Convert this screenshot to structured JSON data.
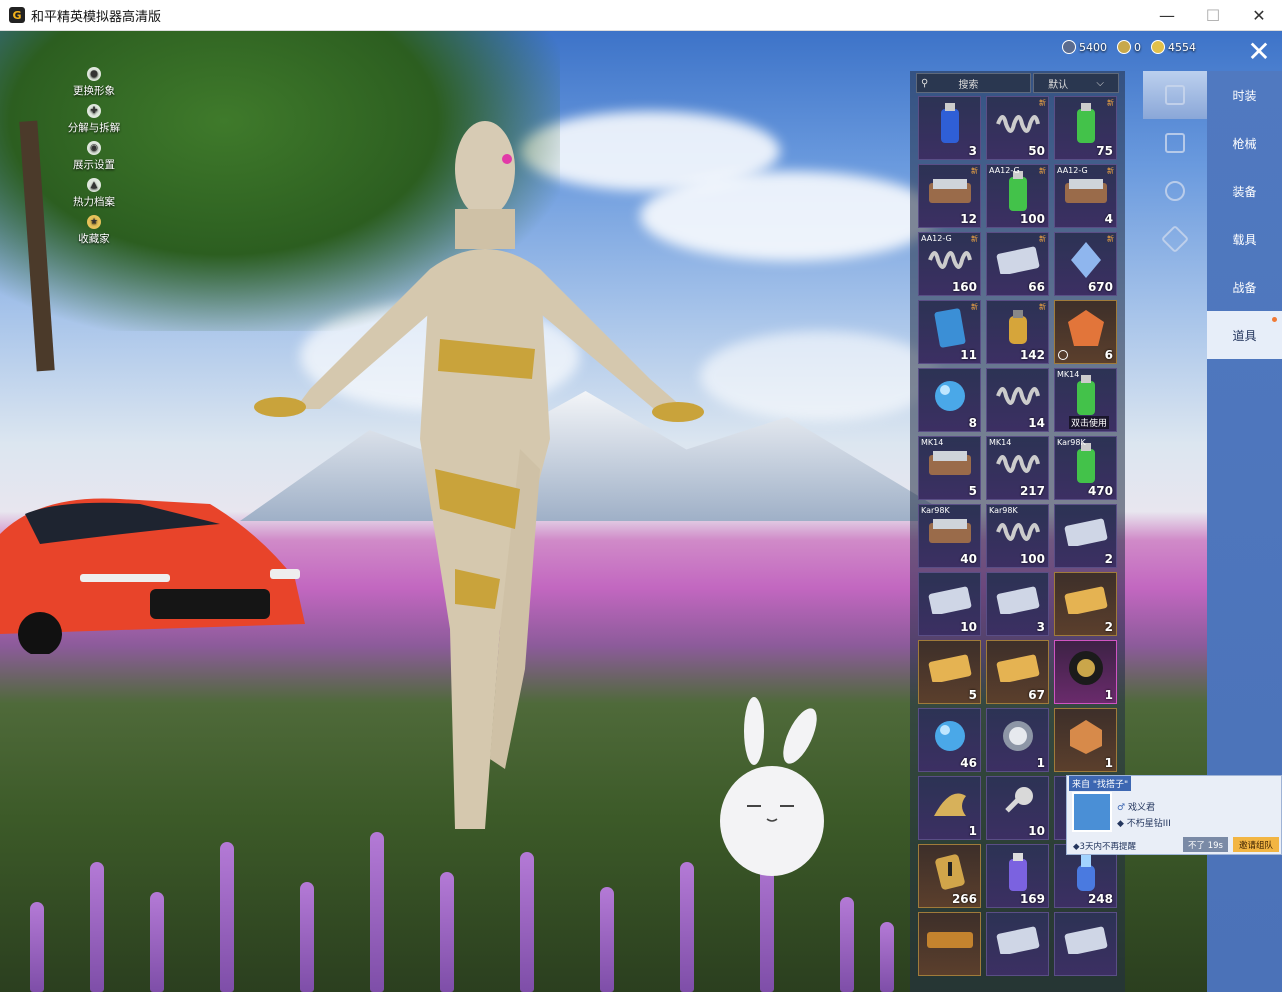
{
  "window": {
    "title": "和平精英模拟器高清版",
    "icon_letter": "G",
    "buttons": [
      "—",
      "☐",
      "✕"
    ]
  },
  "side_menu": [
    {
      "label": "更换形象",
      "icon": "person-icon"
    },
    {
      "label": "分解与拆解",
      "icon": "puzzle-icon"
    },
    {
      "label": "展示设置",
      "icon": "eye-icon"
    },
    {
      "label": "热力档案",
      "icon": "flame-icon"
    },
    {
      "label": "收藏家",
      "icon": "badge-icon"
    }
  ],
  "currency": [
    {
      "value": "5400",
      "color": "#5b6c8f",
      "icon": "coupon-icon"
    },
    {
      "value": "0",
      "color": "#c8a84a",
      "icon": "token-icon"
    },
    {
      "value": "4554",
      "color": "#e2c04a",
      "icon": "gold-coin-icon"
    }
  ],
  "close_label": "✕",
  "inventory": {
    "search_placeholder": "搜索",
    "sort_label": "默认",
    "sort_arrow": "⌵",
    "items": [
      {
        "tag": "",
        "qty": "3",
        "kind": "can-blue",
        "style": ""
      },
      {
        "tag": "",
        "qty": "50",
        "kind": "spring",
        "style": "",
        "new": "新"
      },
      {
        "tag": "",
        "qty": "75",
        "kind": "can-green",
        "style": "",
        "new": "新"
      },
      {
        "tag": "",
        "qty": "12",
        "kind": "case",
        "style": "",
        "new": "新"
      },
      {
        "tag": "AA12-G",
        "qty": "100",
        "kind": "can-green",
        "style": "",
        "new": "新"
      },
      {
        "tag": "AA12-G",
        "qty": "4",
        "kind": "case",
        "style": "",
        "new": "新"
      },
      {
        "tag": "AA12-G",
        "qty": "160",
        "kind": "spring",
        "style": "",
        "new": "新"
      },
      {
        "tag": "",
        "qty": "66",
        "kind": "ticket",
        "style": "",
        "new": "新"
      },
      {
        "tag": "",
        "qty": "670",
        "kind": "diamond",
        "style": "",
        "new": "新"
      },
      {
        "tag": "",
        "qty": "11",
        "kind": "card",
        "style": "",
        "new": "新"
      },
      {
        "tag": "",
        "qty": "142",
        "kind": "grenade",
        "style": "",
        "new": "新"
      },
      {
        "tag": "",
        "qty": "6",
        "kind": "emblem",
        "style": "gold",
        "badge": true
      },
      {
        "tag": "",
        "qty": "8",
        "kind": "orb",
        "style": ""
      },
      {
        "tag": "",
        "qty": "14",
        "kind": "spring",
        "style": ""
      },
      {
        "tag": "MK14",
        "qty": "",
        "kind": "can-green",
        "style": "",
        "action": "双击使用"
      },
      {
        "tag": "MK14",
        "qty": "5",
        "kind": "case",
        "style": ""
      },
      {
        "tag": "MK14",
        "qty": "217",
        "kind": "spring",
        "style": ""
      },
      {
        "tag": "Kar98K",
        "qty": "470",
        "kind": "can-green",
        "style": ""
      },
      {
        "tag": "Kar98K",
        "qty": "40",
        "kind": "case",
        "style": ""
      },
      {
        "tag": "Kar98K",
        "qty": "100",
        "kind": "spring",
        "style": ""
      },
      {
        "tag": "",
        "qty": "2",
        "kind": "ticket",
        "style": ""
      },
      {
        "tag": "",
        "qty": "10",
        "kind": "ticket",
        "style": ""
      },
      {
        "tag": "",
        "qty": "3",
        "kind": "ticket",
        "style": ""
      },
      {
        "tag": "",
        "qty": "2",
        "kind": "ticket-gold",
        "style": "gold"
      },
      {
        "tag": "",
        "qty": "5",
        "kind": "ticket-gold",
        "style": "gold"
      },
      {
        "tag": "",
        "qty": "67",
        "kind": "ticket-gold",
        "style": "gold"
      },
      {
        "tag": "",
        "qty": "1",
        "kind": "lion",
        "style": "pink"
      },
      {
        "tag": "",
        "qty": "46",
        "kind": "orb",
        "style": ""
      },
      {
        "tag": "",
        "qty": "1",
        "kind": "coin",
        "style": ""
      },
      {
        "tag": "",
        "qty": "1",
        "kind": "medal",
        "style": "gold"
      },
      {
        "tag": "",
        "qty": "1",
        "kind": "dragon",
        "style": ""
      },
      {
        "tag": "",
        "qty": "10",
        "kind": "key",
        "style": ""
      },
      {
        "tag": "",
        "qty": "",
        "kind": "blank",
        "style": ""
      },
      {
        "tag": "",
        "qty": "266",
        "kind": "warning",
        "style": "gold"
      },
      {
        "tag": "",
        "qty": "169",
        "kind": "spray",
        "style": ""
      },
      {
        "tag": "",
        "qty": "248",
        "kind": "potion",
        "style": ""
      },
      {
        "tag": "",
        "qty": "",
        "kind": "banner",
        "style": "gold"
      },
      {
        "tag": "",
        "qty": "",
        "kind": "ticket",
        "style": ""
      },
      {
        "tag": "",
        "qty": "",
        "kind": "ticket",
        "style": ""
      }
    ]
  },
  "subtabs": [
    {
      "icon": "card-icon",
      "active": true
    },
    {
      "icon": "calendar-icon",
      "active": false
    },
    {
      "icon": "firework-icon",
      "active": false
    },
    {
      "icon": "voucher-icon",
      "active": false
    }
  ],
  "categories": [
    "时装",
    "枪械",
    "装备",
    "载具",
    "战备",
    "道具"
  ],
  "active_category": "道具",
  "invite": {
    "from": "来自 \"找搭子\"",
    "name": "戏义君",
    "rank": "不朽星钻III",
    "remind": "◆3天内不再提醒",
    "later": "不了 19s",
    "accept": "邀请组队"
  },
  "colors": {
    "accent_blue": "#4b72b8",
    "gold": "#f2b543"
  }
}
